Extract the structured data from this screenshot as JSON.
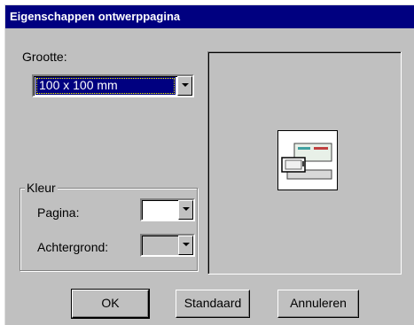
{
  "dialog": {
    "title": "Eigenschappen ontwerppagina"
  },
  "size": {
    "label": "Grootte:",
    "value": "100 x 100 mm"
  },
  "color": {
    "group_label": "Kleur",
    "page_label": "Pagina:",
    "page_value": "",
    "background_label": "Achtergrond:",
    "background_value": ""
  },
  "preview": {
    "icon": "sewing-machine-icon"
  },
  "buttons": {
    "ok": "OK",
    "default": "Standaard",
    "cancel": "Annuleren"
  }
}
